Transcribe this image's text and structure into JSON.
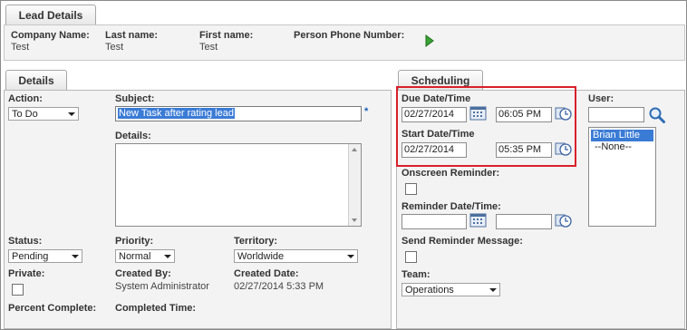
{
  "lead": {
    "tab": "Lead Details",
    "fields": [
      {
        "label": "Company Name:",
        "value": "Test"
      },
      {
        "label": "Last name:",
        "value": "Test"
      },
      {
        "label": "First name:",
        "value": "Test"
      },
      {
        "label": "Person Phone Number:",
        "value": ""
      }
    ]
  },
  "details": {
    "tab": "Details",
    "action_label": "Action:",
    "action_value": "To Do",
    "subject_label": "Subject:",
    "subject_value": "New Task after rating lead",
    "required_marker": "*",
    "details_label": "Details:",
    "details_value": "",
    "status_label": "Status:",
    "status_value": "Pending",
    "priority_label": "Priority:",
    "priority_value": "Normal",
    "territory_label": "Territory:",
    "territory_value": "Worldwide",
    "private_label": "Private:",
    "created_by_label": "Created By:",
    "created_by_value": "System Administrator",
    "created_date_label": "Created Date:",
    "created_date_value": "02/27/2014 5:33 PM",
    "percent_label": "Percent Complete:",
    "completed_label": "Completed Time:"
  },
  "scheduling": {
    "tab": "Scheduling",
    "due_label": "Due Date/Time",
    "due_date": "02/27/2014",
    "due_time": "06:05 PM",
    "start_label": "Start Date/Time",
    "start_date": "02/27/2014",
    "start_time": "05:35 PM",
    "onscreen_label": "Onscreen Reminder:",
    "reminder_label": "Reminder Date/Time:",
    "reminder_date": "",
    "reminder_time": "",
    "send_label": "Send Reminder Message:",
    "team_label": "Team:",
    "team_value": "Operations",
    "user_label": "User:",
    "user_search": "",
    "users": [
      "Brian Little",
      "--None--"
    ],
    "highlight_color": "#d9202a",
    "selection_color": "#3a7bd5"
  }
}
